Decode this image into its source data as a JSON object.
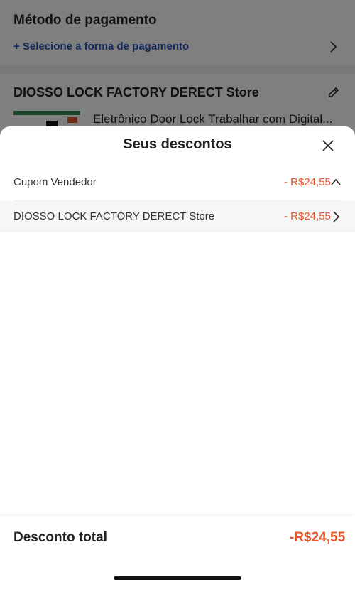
{
  "background": {
    "payment": {
      "title": "Método de pagamento",
      "select_label": "+ Selecione a forma de pagamento"
    },
    "store": {
      "name": "DIOSSO LOCK FACTORY DERECT Store",
      "product_title": "Eletrônico Door Lock Trabalhar com Digital..."
    }
  },
  "sheet": {
    "title": "Seus descontos",
    "coupon": {
      "label": "Cupom Vendedor",
      "amount": "- R$24,55"
    },
    "store_discount": {
      "label": "DIOSSO LOCK FACTORY DERECT Store",
      "amount": "- R$24,55"
    },
    "footer": {
      "total_label": "Desconto total",
      "total_amount": "-R$24,55"
    }
  },
  "colors": {
    "accent": "#e8552b",
    "link": "#2a4fb8"
  },
  "icons": {
    "close": "close-icon",
    "chevron_up": "chevron-up-icon",
    "chevron_right": "chevron-right-icon",
    "edit": "pencil-icon"
  }
}
